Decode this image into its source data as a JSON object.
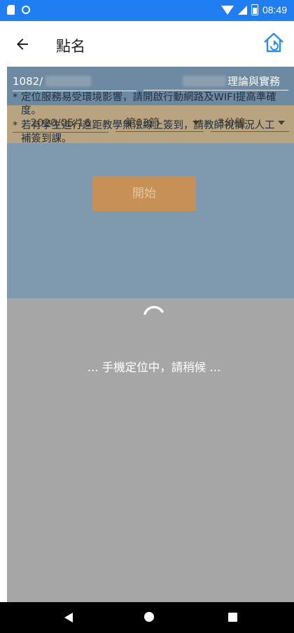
{
  "status_bar": {
    "time": "08:49"
  },
  "app_bar": {
    "title": "點名",
    "back_icon": "arrow-left-icon",
    "home_icon": "home-icon"
  },
  "form": {
    "course_id": "1082/",
    "course_name": "理論與實務",
    "date": "2020/05/16",
    "period": "第03節",
    "duration": "3分鐘",
    "notes": [
      "定位服務易受環境影響，請開啟行動網路及WIFI提高準確度。",
      "若有學生進行遠距教學無法線上簽到，請教師視情況人工補簽到課。"
    ],
    "start_label": "開始"
  },
  "overlay": {
    "loading_text": "... 手機定位中，請稍候 ..."
  },
  "colors": {
    "status_bar": "#1e7ef2",
    "start_button": "#c69056"
  }
}
